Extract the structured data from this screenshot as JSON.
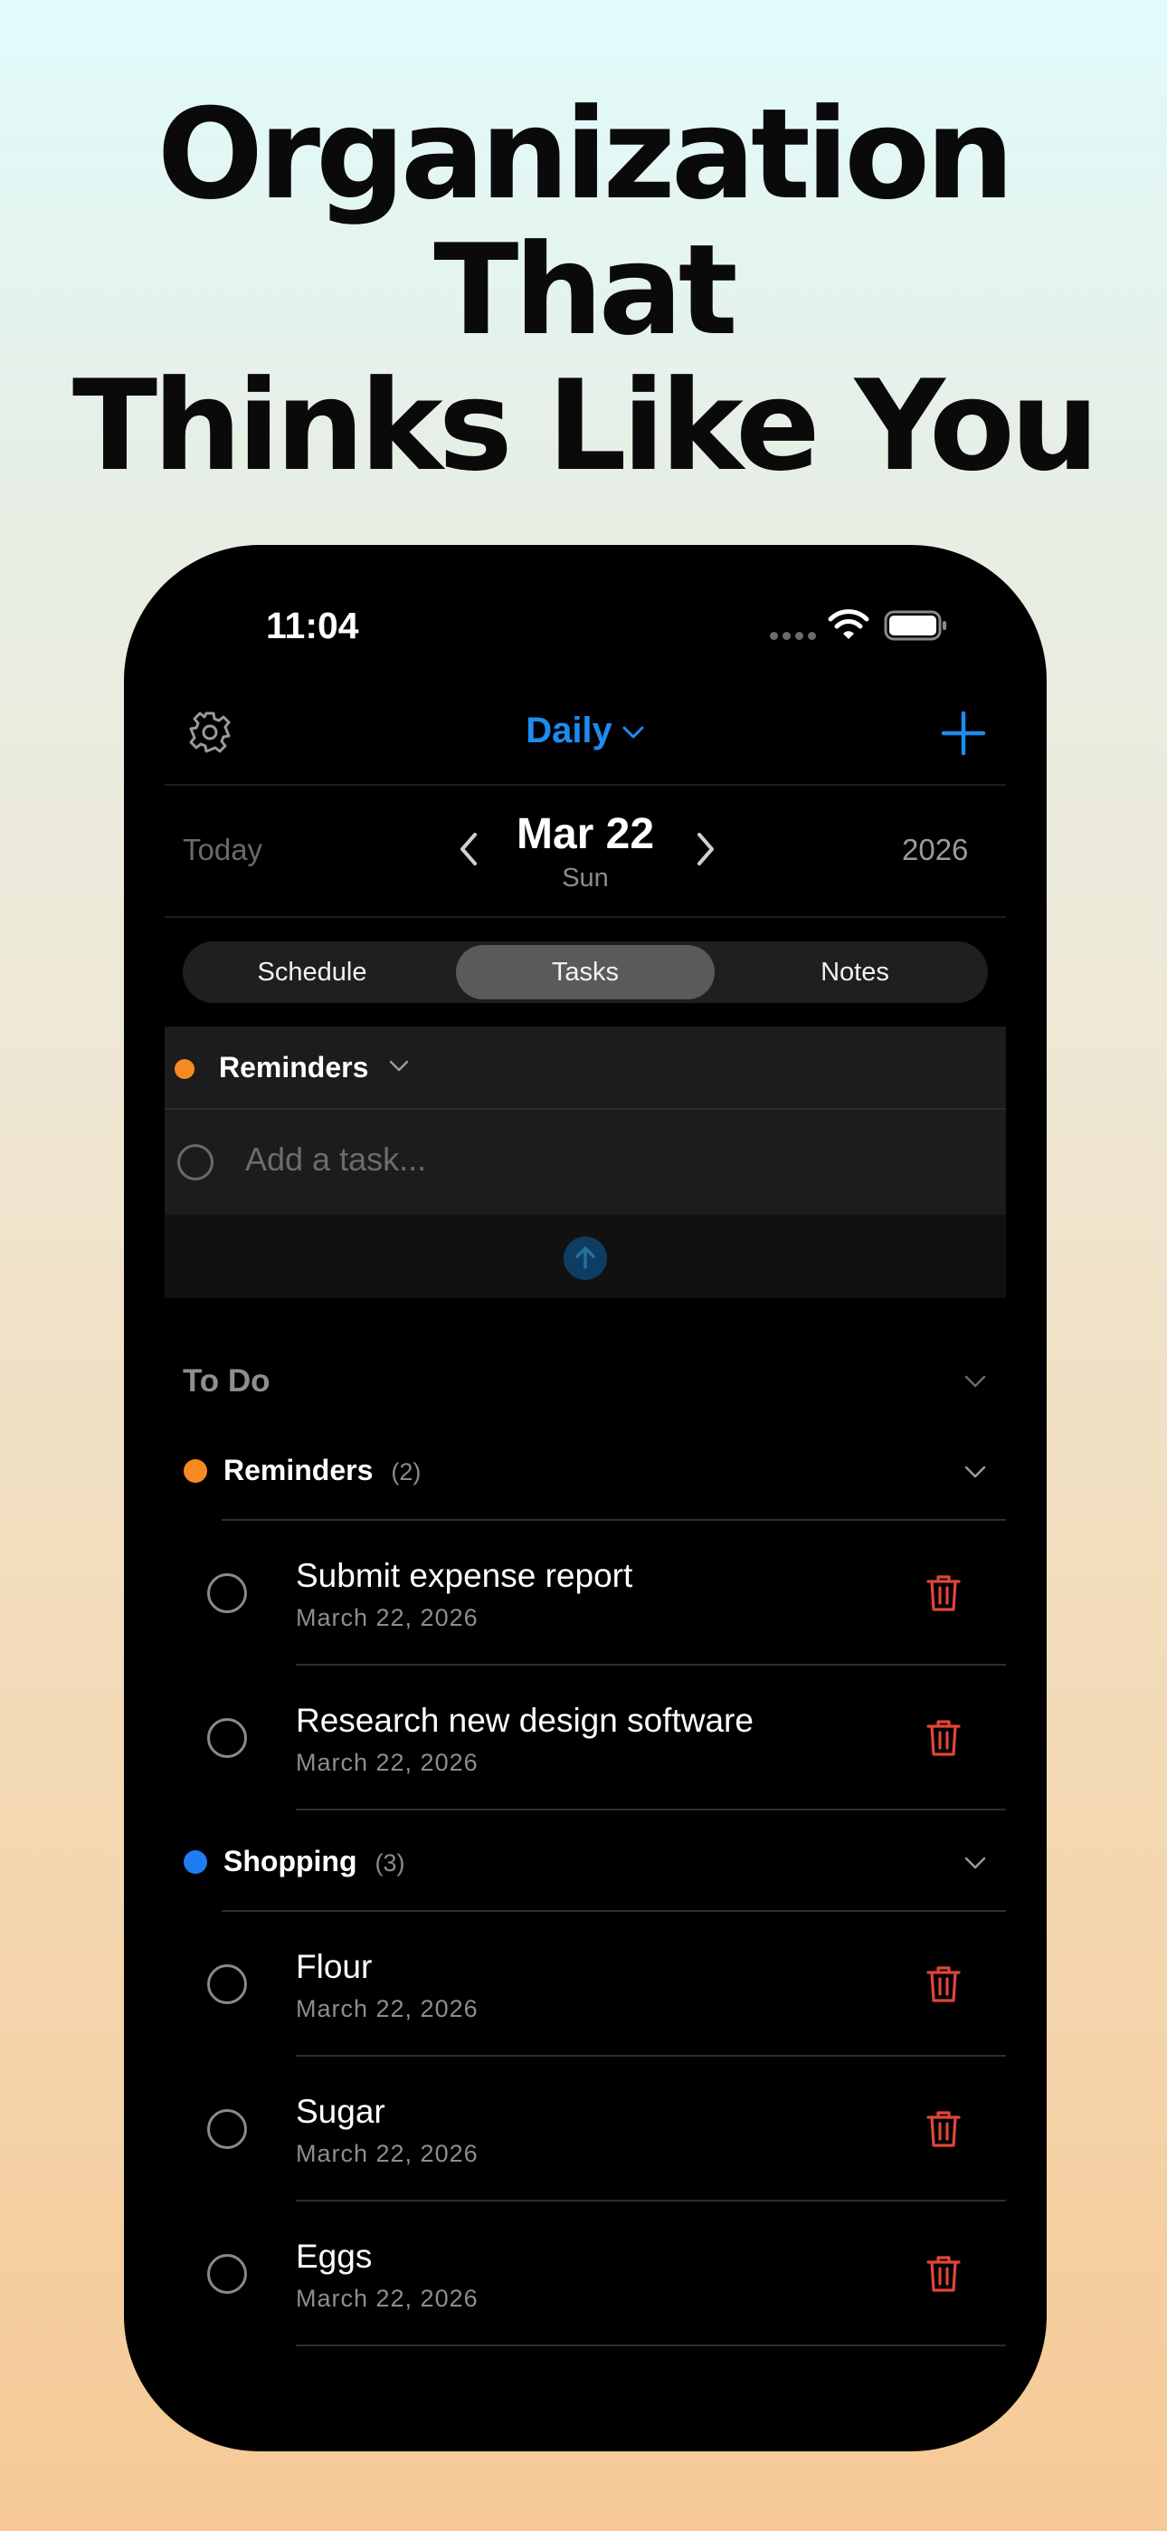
{
  "headline": {
    "line1": "Organization That",
    "line2": "Thinks Like You"
  },
  "status_bar": {
    "time": "11:04"
  },
  "nav": {
    "title": "Daily",
    "settings_icon": "gear-icon",
    "add_icon": "plus-icon"
  },
  "date_bar": {
    "today_label": "Today",
    "date": "Mar 22",
    "weekday": "Sun",
    "year": "2026"
  },
  "tabs": [
    {
      "label": "Schedule",
      "active": false
    },
    {
      "label": "Tasks",
      "active": true
    },
    {
      "label": "Notes",
      "active": false
    }
  ],
  "add_task": {
    "list_label": "Reminders",
    "placeholder": "Add a task..."
  },
  "todo": {
    "title": "To Do",
    "groups": [
      {
        "name": "Reminders",
        "count": "(2)",
        "color": "#f68a22",
        "items": [
          {
            "title": "Submit expense report",
            "date": "March 22, 2026"
          },
          {
            "title": "Research new design software",
            "date": "March 22, 2026"
          }
        ]
      },
      {
        "name": "Shopping",
        "count": "(3)",
        "color": "#1d7cf2",
        "items": [
          {
            "title": "Flour",
            "date": "March 22, 2026"
          },
          {
            "title": "Sugar",
            "date": "March 22, 2026"
          },
          {
            "title": "Eggs",
            "date": "March 22, 2026"
          }
        ]
      }
    ]
  },
  "colors": {
    "accent": "#1d8cf0",
    "delete": "#e0453a"
  }
}
